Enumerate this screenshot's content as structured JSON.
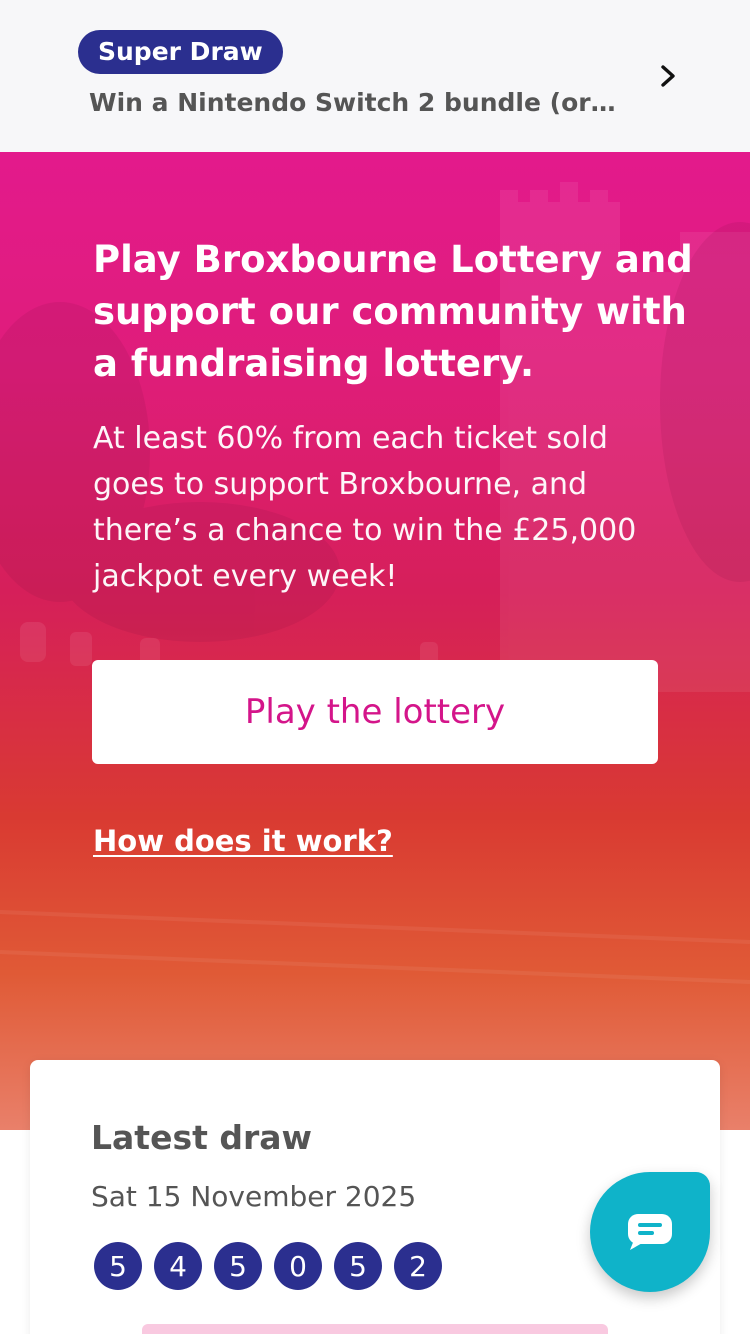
{
  "banner": {
    "badge": "Super Draw",
    "text": "Win a Nintendo Switch 2 bundle (or c…",
    "chevron_icon": "chevron-right-icon"
  },
  "hero": {
    "title": "Play Broxbourne Lottery and support our community with a fundraising lottery.",
    "body": "At least 60% from each ticket sold goes to support Broxbourne, and there’s a chance to win the £25,000 jackpot every week!",
    "cta_label": "Play the lottery",
    "link_label": "How does it work?"
  },
  "latest_draw": {
    "title": "Latest draw",
    "date": "Sat 15 November 2025",
    "numbers": [
      "5",
      "4",
      "5",
      "0",
      "5",
      "2"
    ]
  },
  "chat": {
    "icon": "chat-icon"
  },
  "colors": {
    "brand_navy": "#2b2f8f",
    "brand_pink": "#d4158a",
    "hero_top": "#e31a8c",
    "hero_bottom": "#e05a36",
    "chat_teal": "#0fb3c9"
  }
}
